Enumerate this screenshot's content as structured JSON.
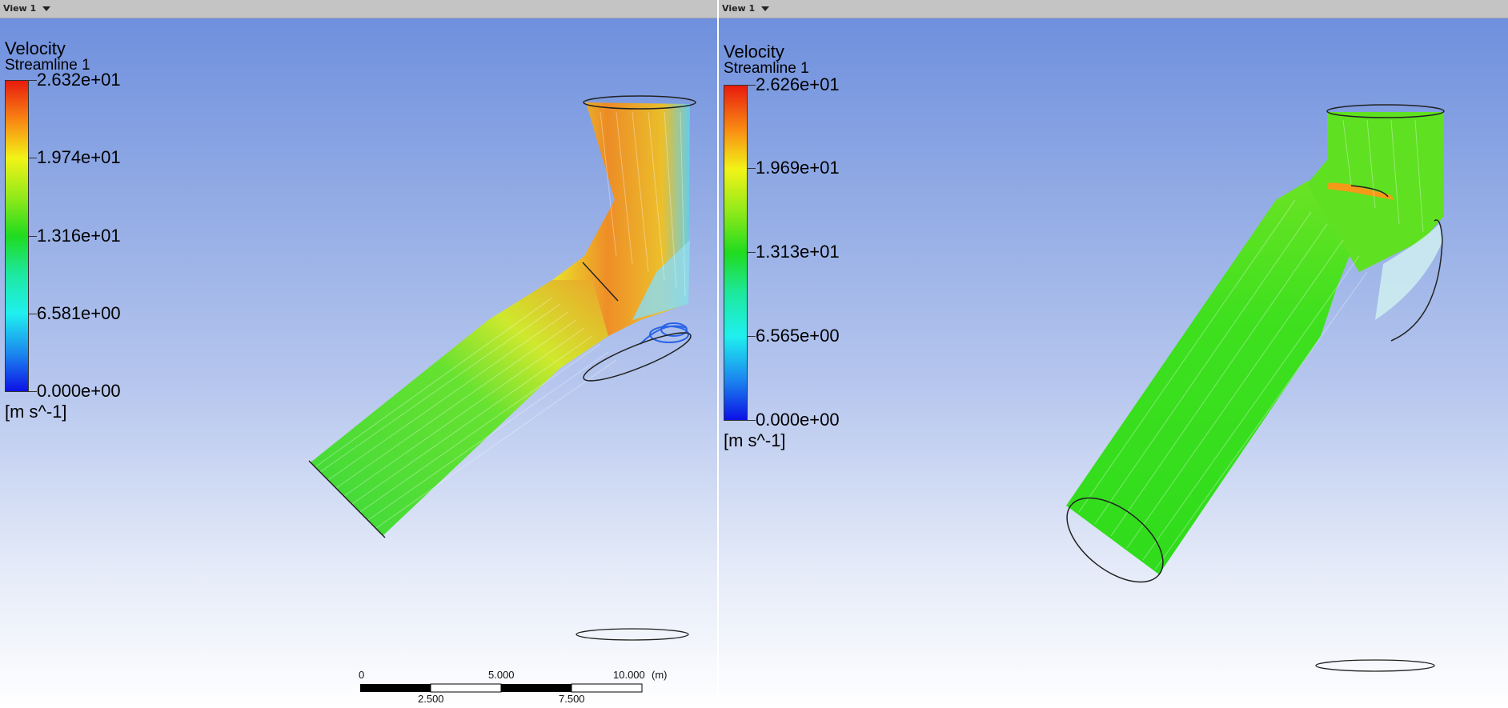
{
  "left_view": {
    "tab_label": "View 1",
    "legend": {
      "variable": "Velocity",
      "object": "Streamline 1",
      "ticks": [
        "2.632e+01",
        "1.974e+01",
        "1.316e+01",
        "6.581e+00",
        "0.000e+00"
      ],
      "unit": "[m s^-1]"
    },
    "scale": {
      "top_labels": [
        "0",
        "5.000",
        "10.000"
      ],
      "unit": "(m)",
      "bottom_labels": [
        "2.500",
        "7.500"
      ]
    }
  },
  "right_view": {
    "tab_label": "View 1",
    "legend": {
      "variable": "Velocity",
      "object": "Streamline 1",
      "ticks": [
        "2.626e+01",
        "1.969e+01",
        "1.313e+01",
        "6.565e+00",
        "0.000e+00"
      ],
      "unit": "[m s^-1]"
    }
  },
  "colormap": [
    "#e81b0e",
    "#f98a13",
    "#f2f417",
    "#8ee91a",
    "#1fdb1f",
    "#1de89d",
    "#1ff0ef",
    "#1b86ef",
    "#0c11e5"
  ],
  "background_gradient": [
    "#6b8ddd",
    "#ffffff"
  ]
}
